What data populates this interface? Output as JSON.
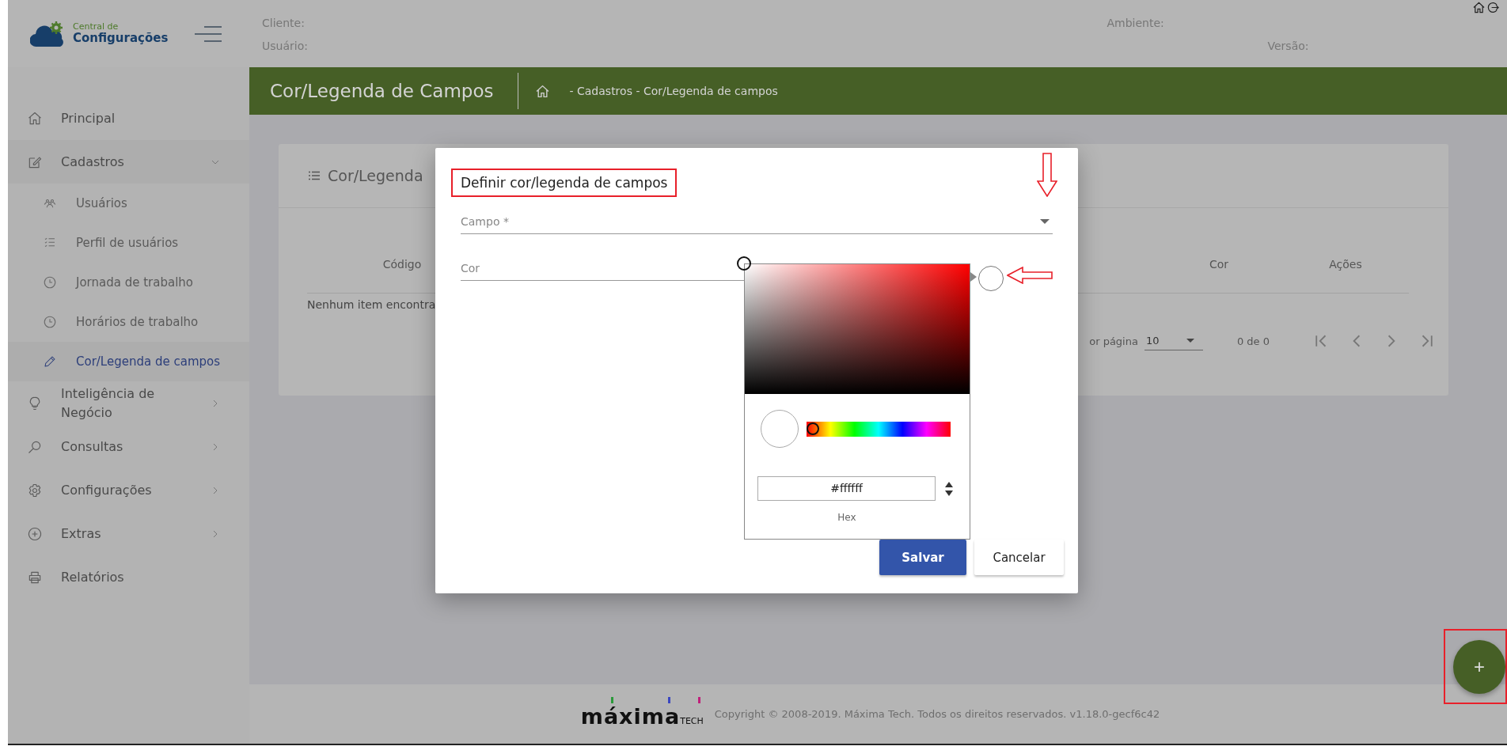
{
  "header": {
    "logo": {
      "line1": "Central de",
      "line2": "Configurações"
    },
    "fields": [
      {
        "label": "Cliente:",
        "kind": "left"
      },
      {
        "label": "Usuário:",
        "kind": "left"
      },
      {
        "label": "Ambiente:",
        "kind": "right"
      },
      {
        "label": "Versão:",
        "kind": "right"
      }
    ]
  },
  "sidebar": {
    "items": [
      {
        "label": "Principal"
      },
      {
        "label": "Cadastros",
        "expanded": true,
        "children": [
          {
            "label": "Usuários",
            "selected": false
          },
          {
            "label": "Perfil de usuários",
            "selected": false
          },
          {
            "label": "Jornada de trabalho",
            "selected": false
          },
          {
            "label": "Horários de trabalho",
            "selected": false
          },
          {
            "label": "Cor/Legenda de campos",
            "selected": true
          }
        ]
      },
      {
        "label": "Inteligência de Negócio",
        "expanded": false
      },
      {
        "label": "Consultas",
        "expanded": false
      },
      {
        "label": "Configurações",
        "expanded": false
      },
      {
        "label": "Extras",
        "expanded": false
      },
      {
        "label": "Relatórios"
      }
    ]
  },
  "page_header": {
    "title": "Cor/Legenda de Campos",
    "breadcrumb": "- Cadastros - Cor/Legenda de campos"
  },
  "card": {
    "title": "Cor/Legenda",
    "table": {
      "columns": [
        "Código",
        "Cor",
        "Ações"
      ],
      "empty_message": "Nenhum item encontra"
    },
    "paginator": {
      "label": "or página",
      "page_size": "10",
      "range": "0 de 0"
    }
  },
  "dialog": {
    "title": "Definir cor/legenda de campos",
    "highlighted": true,
    "fields": [
      {
        "label": "Campo *",
        "kind": "select"
      },
      {
        "label": "Cor",
        "kind": "color"
      }
    ],
    "color_picker": {
      "hex": "#ffffff",
      "format": "Hex",
      "hue": {
        "level": 0
      }
    },
    "buttons": [
      {
        "label": "Salvar",
        "kind": "primary"
      },
      {
        "label": "Cancelar",
        "kind": "secondary"
      }
    ]
  },
  "fab": {
    "label": "+",
    "highlighted": true
  },
  "footer": {
    "brand": "máxima",
    "brand_suffix": "TECH",
    "copyright": "Copyright © 2008-2019. Máxima Tech. Todos os direitos reservados. v1.18.0-gecf6c42"
  }
}
